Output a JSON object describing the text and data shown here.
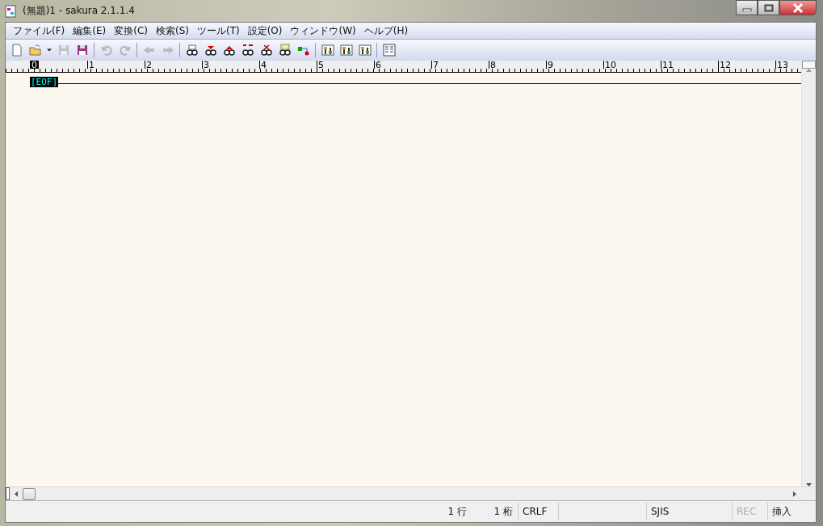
{
  "window": {
    "title": "(無題)1 - sakura 2.1.1.4"
  },
  "menu": [
    "ファイル(F)",
    "編集(E)",
    "変換(C)",
    "検索(S)",
    "ツール(T)",
    "設定(O)",
    "ウィンドウ(W)",
    "ヘルプ(H)"
  ],
  "toolbar": [
    [
      {
        "kind": "new",
        "disabled": false
      },
      {
        "kind": "open",
        "disabled": false
      },
      {
        "kind": "dropdown",
        "disabled": false
      },
      {
        "kind": "save",
        "disabled": true
      },
      {
        "kind": "saveas",
        "disabled": false
      }
    ],
    [
      {
        "kind": "undo",
        "disabled": true
      },
      {
        "kind": "redo",
        "disabled": true
      }
    ],
    [
      {
        "kind": "back",
        "disabled": true
      },
      {
        "kind": "forward",
        "disabled": true
      }
    ],
    [
      {
        "kind": "find",
        "disabled": false
      },
      {
        "kind": "find-down",
        "disabled": false
      },
      {
        "kind": "find-up",
        "disabled": false
      },
      {
        "kind": "replace",
        "disabled": false
      },
      {
        "kind": "clear",
        "disabled": false
      },
      {
        "kind": "grep",
        "disabled": false
      },
      {
        "kind": "jump",
        "disabled": false
      }
    ],
    [
      {
        "kind": "settings",
        "disabled": false
      },
      {
        "kind": "settings",
        "disabled": false
      },
      {
        "kind": "settings",
        "disabled": false
      }
    ],
    [
      {
        "kind": "outline",
        "disabled": false
      }
    ]
  ],
  "ruler": [
    "0",
    "1",
    "2",
    "3",
    "4",
    "5",
    "6",
    "7",
    "8",
    "9",
    "10",
    "11",
    "12",
    "13"
  ],
  "editor": {
    "eof": "[EOF]"
  },
  "status_bar": [
    {
      "text": "1 行",
      "disabled": false
    },
    {
      "text": "1 桁",
      "disabled": false
    },
    {
      "text": "CRLF",
      "disabled": false
    },
    {
      "text": "SJIS",
      "disabled": false
    },
    {
      "text": "REC",
      "disabled": true
    },
    {
      "text": "挿入",
      "disabled": false
    }
  ]
}
